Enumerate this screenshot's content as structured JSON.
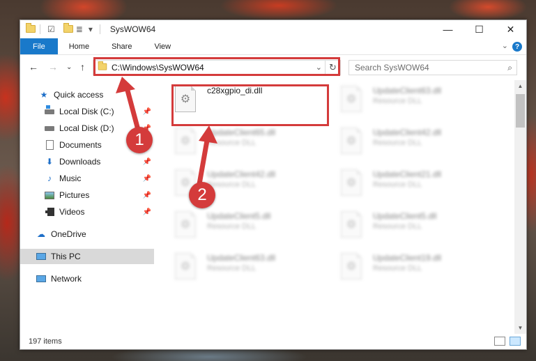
{
  "window": {
    "title": "SysWOW64",
    "controls": {
      "minimize": "—",
      "maximize": "☐",
      "close": "✕"
    }
  },
  "ribbon": {
    "tabs": [
      "File",
      "Home",
      "Share",
      "View"
    ],
    "help": "?"
  },
  "navigation": {
    "address": "C:\\Windows\\SysWOW64",
    "search_placeholder": "Search SysWOW64"
  },
  "sidebar": {
    "items": [
      {
        "label": "Quick access",
        "icon": "star-icon",
        "pinned": false
      },
      {
        "label": "Local Disk (C:)",
        "icon": "drive-icon",
        "pinned": true
      },
      {
        "label": "Local Disk (D:)",
        "icon": "drive-icon",
        "pinned": true
      },
      {
        "label": "Documents",
        "icon": "document-icon",
        "pinned": true
      },
      {
        "label": "Downloads",
        "icon": "download-icon",
        "pinned": true
      },
      {
        "label": "Music",
        "icon": "music-icon",
        "pinned": true
      },
      {
        "label": "Pictures",
        "icon": "pictures-icon",
        "pinned": true
      },
      {
        "label": "Videos",
        "icon": "videos-icon",
        "pinned": true
      },
      {
        "label": "OneDrive",
        "icon": "cloud-icon",
        "pinned": false
      },
      {
        "label": "This PC",
        "icon": "computer-icon",
        "pinned": false
      },
      {
        "label": "Network",
        "icon": "network-icon",
        "pinned": false
      }
    ]
  },
  "files": [
    {
      "name": "c28xgpio_di.dll",
      "type": ""
    },
    {
      "name": "UpdateClient63.dll",
      "type": "Resource DLL"
    },
    {
      "name": "UpdateClient65.dll",
      "type": "Resource DLL"
    },
    {
      "name": "UpdateClient42.dll",
      "type": "Resource DLL"
    },
    {
      "name": "UpdateClient42.dll",
      "type": "Resource DLL"
    },
    {
      "name": "UpdateClient21.dll",
      "type": "Resource DLL"
    },
    {
      "name": "UpdateClient5.dll",
      "type": "Resource DLL"
    },
    {
      "name": "UpdateClient5.dll",
      "type": "Resource DLL"
    },
    {
      "name": "UpdateClient63.dll",
      "type": "Resource DLL"
    },
    {
      "name": "UpdateClient19.dll",
      "type": "Resource DLL"
    }
  ],
  "status": {
    "item_count": "197 items"
  },
  "annotations": {
    "step1": "1",
    "step2": "2",
    "color": "#d43b3b"
  }
}
